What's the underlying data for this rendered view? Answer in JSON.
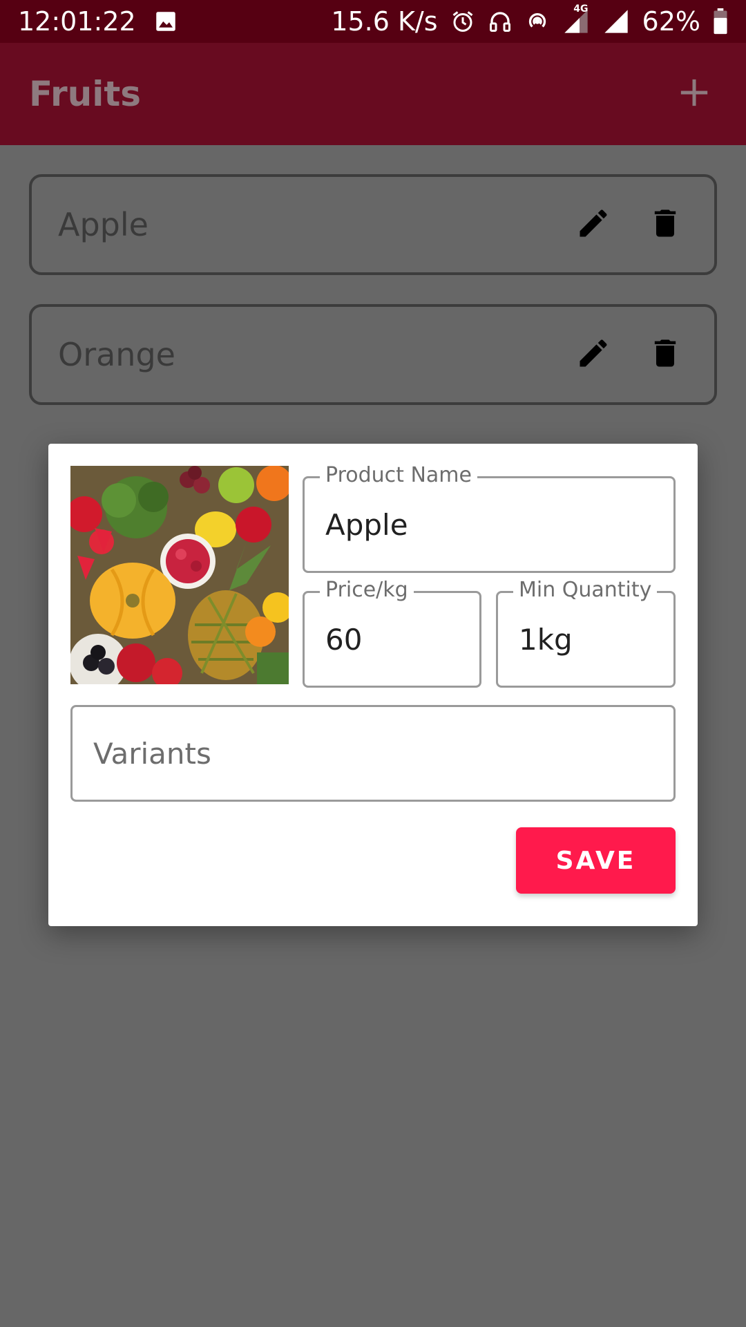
{
  "status_bar": {
    "time": "12:01:22",
    "net_speed": "15.6 K/s",
    "network_type": "4G",
    "battery": "62%",
    "icons": [
      "image-icon",
      "alarm-icon",
      "headset-icon",
      "hotspot-icon",
      "signal-4g-icon",
      "signal-icon",
      "battery-icon"
    ]
  },
  "app_bar": {
    "title": "Fruits",
    "action_icon": "plus-icon"
  },
  "list": {
    "items": [
      {
        "label": "Apple",
        "actions": [
          "edit-icon",
          "delete-icon"
        ]
      },
      {
        "label": "Orange",
        "actions": [
          "edit-icon",
          "delete-icon"
        ]
      }
    ]
  },
  "dialog": {
    "image_alt": "fruits-image",
    "product_name": {
      "label": "Product Name",
      "value": "Apple"
    },
    "price": {
      "label": "Price/kg",
      "value": "60"
    },
    "min_quantity": {
      "label": "Min Quantity",
      "value": "1kg"
    },
    "variants": {
      "placeholder": "Variants",
      "value": ""
    },
    "save_label": "SAVE"
  },
  "colors": {
    "status_bar": "#560012",
    "app_bar": "#680b20",
    "scrim_background": "#676767",
    "save_button": "#ff1a4c"
  }
}
